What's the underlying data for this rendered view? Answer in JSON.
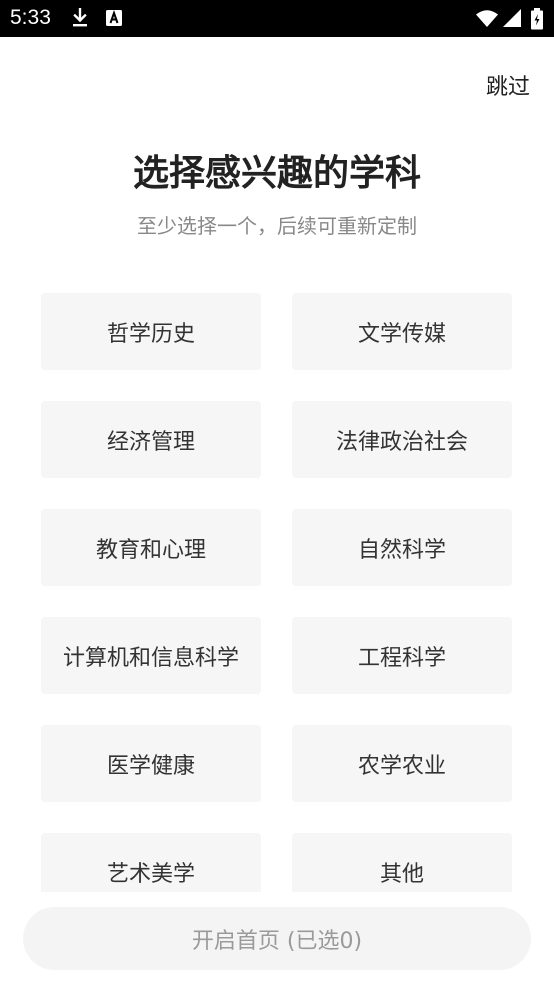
{
  "status_bar": {
    "time": "5:33",
    "icons": [
      "download-icon",
      "a-badge-icon",
      "wifi-icon",
      "signal-icon",
      "battery-icon"
    ]
  },
  "header": {
    "skip_label": "跳过"
  },
  "intro": {
    "title": "选择感兴趣的学科",
    "subtitle": "至少选择一个，后续可重新定制"
  },
  "subjects": [
    {
      "label": "哲学历史"
    },
    {
      "label": "文学传媒"
    },
    {
      "label": "经济管理"
    },
    {
      "label": "法律政治社会"
    },
    {
      "label": "教育和心理"
    },
    {
      "label": "自然科学"
    },
    {
      "label": "计算机和信息科学"
    },
    {
      "label": "工程科学"
    },
    {
      "label": "医学健康"
    },
    {
      "label": "农学农业"
    },
    {
      "label": "艺术美学"
    },
    {
      "label": "其他"
    }
  ],
  "footer": {
    "start_label": "开启首页 (已选0)"
  },
  "colors": {
    "status_bar_bg": "#000000",
    "card_bg": "#f6f6f6",
    "title_text": "#222222",
    "muted_text": "#888888",
    "button_bg": "#f4f4f4",
    "button_text": "#9a9a9a"
  }
}
